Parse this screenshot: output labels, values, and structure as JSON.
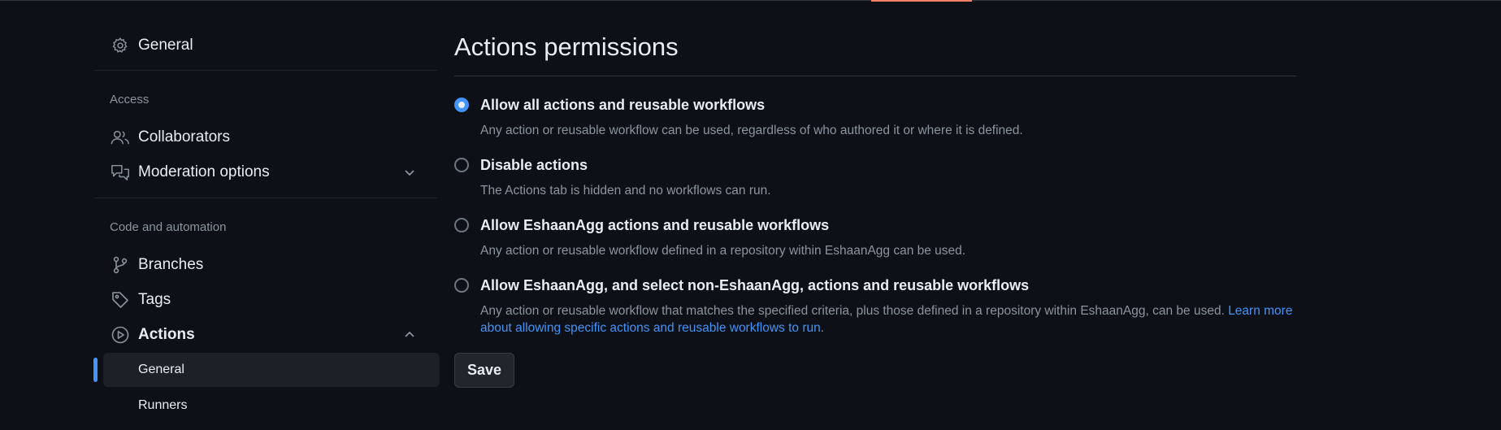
{
  "sidebar": {
    "general": "General",
    "access_heading": "Access",
    "collaborators": "Collaborators",
    "moderation": "Moderation options",
    "code_heading": "Code and automation",
    "branches": "Branches",
    "tags": "Tags",
    "actions": "Actions",
    "actions_general": "General",
    "runners": "Runners"
  },
  "main": {
    "title": "Actions permissions",
    "options": [
      {
        "label": "Allow all actions and reusable workflows",
        "desc": "Any action or reusable workflow can be used, regardless of who authored it or where it is defined.",
        "checked": true
      },
      {
        "label": "Disable actions",
        "desc": "The Actions tab is hidden and no workflows can run.",
        "checked": false
      },
      {
        "label": "Allow EshaanAgg actions and reusable workflows",
        "desc": "Any action or reusable workflow defined in a repository within EshaanAgg can be used.",
        "checked": false
      },
      {
        "label": "Allow EshaanAgg, and select non-EshaanAgg, actions and reusable workflows",
        "desc": "Any action or reusable workflow that matches the specified criteria, plus those defined in a repository within EshaanAgg, can be used.",
        "link": "Learn more about allowing specific actions and reusable workflows to run",
        "link_suffix": ".",
        "checked": false
      }
    ],
    "save_label": "Save"
  },
  "icons": {
    "general": "gear-icon",
    "collaborators": "people-icon",
    "moderation": "comment-discussion-icon",
    "branches": "git-branch-icon",
    "tags": "tag-icon",
    "actions": "play-icon"
  },
  "colors": {
    "background": "#0d1117",
    "accent": "#4493f8",
    "text": "#e6edf3",
    "muted": "#8b949e"
  }
}
